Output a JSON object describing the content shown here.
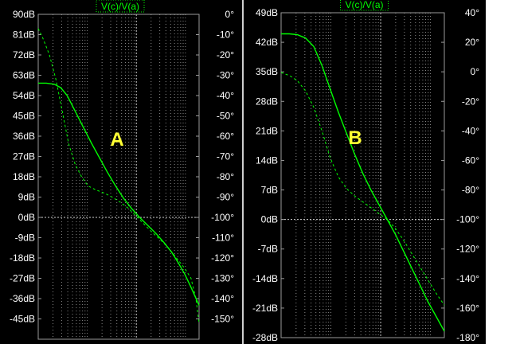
{
  "colors": {
    "background": "#000000",
    "trace": "#00ff00",
    "grid": "#8a8a8a",
    "text": "#ffffff",
    "annotation": "#ffff33",
    "separator": "#cfcfcf"
  },
  "chart_data": [
    {
      "type": "line",
      "title": "V(c)/V(a)",
      "annotation": "A",
      "x_scale": "log",
      "grid": true,
      "left_axis": {
        "unit": "dB",
        "ticks": [
          "90dB",
          "81dB",
          "72dB",
          "63dB",
          "54dB",
          "45dB",
          "36dB",
          "27dB",
          "18dB",
          "9dB",
          "0dB",
          "-9dB",
          "-18dB",
          "-27dB",
          "-36dB",
          "-45dB"
        ],
        "tick_values": [
          90,
          81,
          72,
          63,
          54,
          45,
          36,
          27,
          18,
          9,
          0,
          -9,
          -18,
          -27,
          -36,
          -45
        ],
        "range": [
          -54,
          90
        ]
      },
      "right_axis": {
        "unit": "°",
        "ticks": [
          "0°",
          "-10°",
          "-20°",
          "-30°",
          "-40°",
          "-50°",
          "-60°",
          "-70°",
          "-80°",
          "-90°",
          "-100°",
          "-110°",
          "-120°",
          "-130°",
          "-140°",
          "-150°"
        ],
        "tick_values": [
          0,
          -10,
          -20,
          -30,
          -40,
          -50,
          -60,
          -70,
          -80,
          -90,
          -100,
          -110,
          -120,
          -130,
          -140,
          -150
        ],
        "range": [
          -160,
          0
        ]
      },
      "series": [
        {
          "style": "solid",
          "axis": "left",
          "x": [
            0.0,
            0.05,
            0.1,
            0.14,
            0.18,
            0.23,
            0.28,
            0.33,
            0.38,
            0.43,
            0.48,
            0.53,
            0.58,
            0.63,
            0.68,
            0.73,
            0.78,
            0.83,
            0.87,
            0.91,
            0.95,
            1.0
          ],
          "y": [
            59.5,
            59.5,
            59.0,
            57.5,
            54.0,
            47.0,
            40.0,
            33.0,
            26.5,
            20.0,
            14.0,
            8.5,
            4.0,
            0.0,
            -3.5,
            -7.0,
            -11.0,
            -15.5,
            -20.0,
            -25.0,
            -31.0,
            -39.0
          ]
        },
        {
          "style": "dashed",
          "axis": "right",
          "x": [
            0.0,
            0.03,
            0.07,
            0.11,
            0.15,
            0.19,
            0.23,
            0.27,
            0.31,
            0.36,
            0.41,
            0.46,
            0.51,
            0.56,
            0.61,
            0.66,
            0.71,
            0.76,
            0.81,
            0.86,
            0.91,
            0.95,
            0.98,
            1.0
          ],
          "y": [
            -7.0,
            -12.0,
            -20.0,
            -32.0,
            -48.0,
            -64.0,
            -74.0,
            -80.0,
            -84.5,
            -86.5,
            -88.0,
            -90.0,
            -92.5,
            -95.5,
            -99.5,
            -103.5,
            -107.5,
            -111.0,
            -115.0,
            -120.0,
            -125.0,
            -130.0,
            -140.0,
            -152.0
          ]
        }
      ]
    },
    {
      "type": "line",
      "title": "V(c)/V(a)",
      "annotation": "B",
      "x_scale": "log",
      "grid": true,
      "left_axis": {
        "unit": "dB",
        "ticks": [
          "49dB",
          "42dB",
          "35dB",
          "28dB",
          "21dB",
          "14dB",
          "7dB",
          "0dB",
          "-7dB",
          "-14dB",
          "-21dB",
          "-28dB"
        ],
        "tick_values": [
          49,
          42,
          35,
          28,
          21,
          14,
          7,
          0,
          -7,
          -14,
          -21,
          -28
        ],
        "range": [
          -28,
          49
        ]
      },
      "right_axis": {
        "unit": "°",
        "ticks": [
          "40°",
          "20°",
          "0°",
          "-20°",
          "-40°",
          "-60°",
          "-80°",
          "-100°",
          "-120°",
          "-140°",
          "-160°",
          "-180°"
        ],
        "tick_values": [
          40,
          20,
          0,
          -20,
          -40,
          -60,
          -80,
          -100,
          -120,
          -140,
          -160,
          -180
        ],
        "range": [
          -180,
          40
        ]
      },
      "series": [
        {
          "style": "solid",
          "axis": "left",
          "x": [
            0.0,
            0.05,
            0.1,
            0.15,
            0.2,
            0.25,
            0.3,
            0.35,
            0.4,
            0.45,
            0.5,
            0.55,
            0.6,
            0.65,
            0.7,
            0.75,
            0.8,
            0.85,
            0.9,
            0.95,
            1.0
          ],
          "y": [
            44.0,
            44.0,
            43.8,
            43.0,
            41.0,
            36.5,
            31.0,
            25.5,
            20.5,
            15.5,
            11.0,
            7.0,
            3.5,
            0.0,
            -3.5,
            -7.5,
            -11.5,
            -15.5,
            -19.5,
            -23.0,
            -26.5
          ]
        },
        {
          "style": "dashed",
          "axis": "right",
          "x": [
            0.0,
            0.05,
            0.1,
            0.15,
            0.2,
            0.25,
            0.3,
            0.35,
            0.4,
            0.45,
            0.5,
            0.55,
            0.6,
            0.65,
            0.7,
            0.75,
            0.8,
            0.85,
            0.9,
            0.95,
            1.0
          ],
          "y": [
            -0.5,
            -2.5,
            -6.0,
            -13.0,
            -24.0,
            -40.0,
            -58.0,
            -71.0,
            -79.0,
            -84.0,
            -88.0,
            -92.0,
            -96.0,
            -100.0,
            -106.0,
            -114.0,
            -123.0,
            -132.0,
            -141.0,
            -150.0,
            -158.0
          ]
        }
      ]
    }
  ]
}
